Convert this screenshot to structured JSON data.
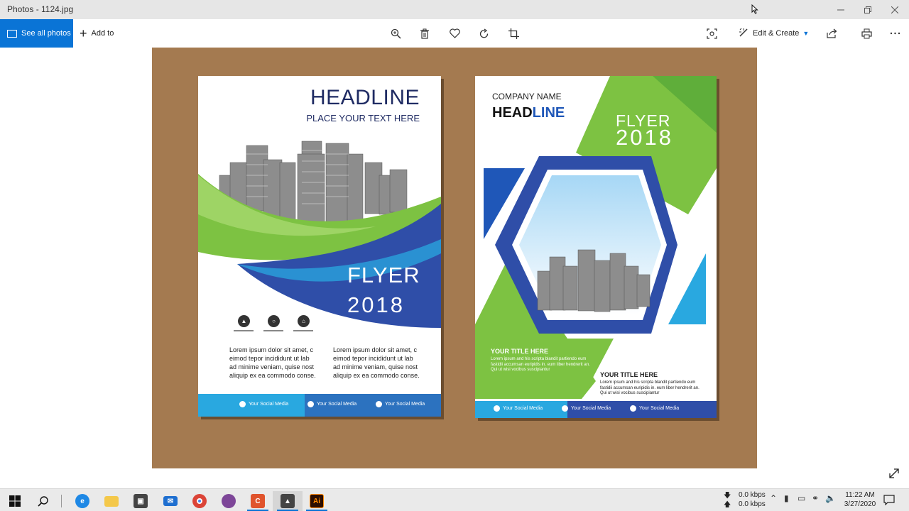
{
  "window": {
    "title": "Photos - 1124.jpg",
    "minimize_icon": "minimize-icon",
    "maximize_icon": "restore-icon",
    "close_icon": "close-icon"
  },
  "toolbar": {
    "see_all_label": "See all photos",
    "add_to_label": "Add to",
    "edit_create_label": "Edit & Create",
    "icons": [
      "zoom-icon",
      "delete-icon",
      "favorite-icon",
      "rotate-icon",
      "crop-icon",
      "enhance-icon",
      "share-icon",
      "print-icon",
      "more-icon"
    ]
  },
  "poster_left": {
    "headline": "HEADLINE",
    "subheadline": "PLACE YOUR TEXT HERE",
    "flyer": "FLYER",
    "year": "2018",
    "lorem_left": "Lorem ipsum dolor sit amet, c eimod tepor incididunt ut lab ad minime veniam, quise nost aliquip ex ea commodo conse.",
    "lorem_right": "Lorem ipsum dolor sit amet, c eimod tepor incididunt ut lab ad minime veniam, quise nost aliquip ex ea commodo conse.",
    "social": [
      "Your Social Media",
      "Your Social Media",
      "Your Social Media"
    ],
    "colors": {
      "green": "#7dc242",
      "blue": "#2f4ea8",
      "navy": "#1f2b63",
      "cyan": "#29a8e0"
    }
  },
  "poster_right": {
    "company": "COMPANY NAME",
    "headline_a": "HEAD",
    "headline_b": "LINE",
    "flyer": "FLYER",
    "year": "2018",
    "title1": "YOUR TITLE HERE",
    "text1": "Lorem ipsum and his scripta blandit partiendo eum fastidii accumsan euripidis in. eum liber hendrerit an. Qui ut wisi vocibus suscipiantur",
    "title2": "YOUR TITLE HERE",
    "text2": "Lorem ipsum and his scripta blandit partiendo eum fastidii accumsan euripidis in. eum liber hendrerit an. Qui ut wisi vocibus suscipiantur",
    "social": [
      "Your Social Media",
      "Your Social Media",
      "Your Social Media"
    ]
  },
  "taskbar": {
    "apps": [
      "windows-start-icon",
      "search-icon",
      "edge-icon",
      "file-explorer-icon",
      "store-icon",
      "mail-icon",
      "chrome-icon",
      "tor-browser-icon",
      "camtasia-icon",
      "photos-icon",
      "illustrator-icon"
    ],
    "illustrator_label": "Ai",
    "net_down": "0.0 kbps",
    "net_up": "0.0 kbps",
    "time": "11:22 AM",
    "date": "3/27/2020"
  }
}
